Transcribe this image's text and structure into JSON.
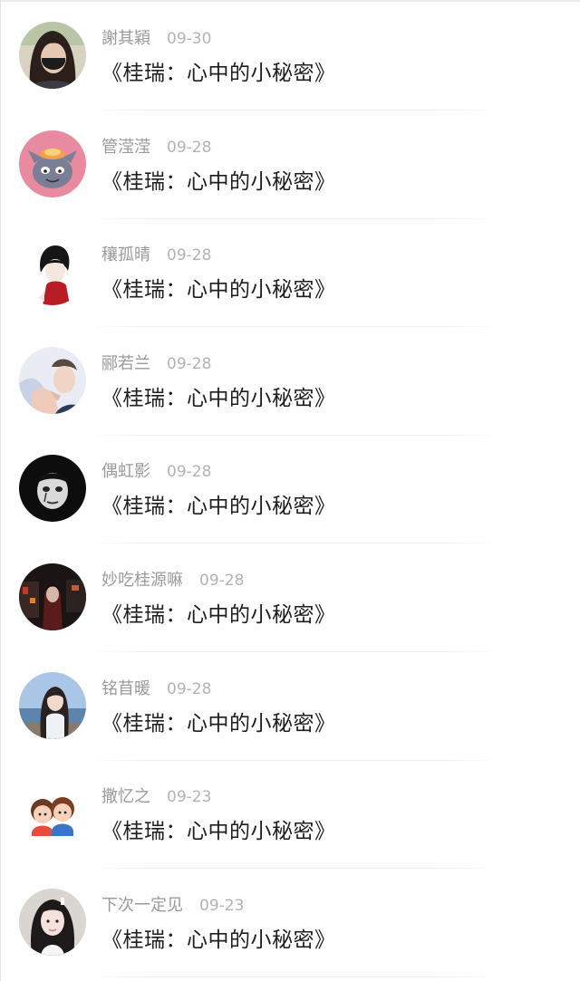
{
  "comments": [
    {
      "user": "謝其穎",
      "time": "09-30",
      "text": "《桂瑞：心中的小秘密》",
      "avatar": "girl-with-mask-avatar"
    },
    {
      "user": "管滢滢",
      "time": "09-28",
      "text": "《桂瑞：心中的小秘密》",
      "avatar": "cartoon-cat-avatar"
    },
    {
      "user": "穰孤晴",
      "time": "09-28",
      "text": "《桂瑞：心中的小秘密》",
      "avatar": "anime-boy-avatar"
    },
    {
      "user": "郦若兰",
      "time": "09-28",
      "text": "《桂瑞：心中的小秘密》",
      "avatar": "boy-portrait-avatar"
    },
    {
      "user": "偶虹影",
      "time": "09-28",
      "text": "《桂瑞：心中的小秘密》",
      "avatar": "dark-face-avatar"
    },
    {
      "user": "妙吃桂源嘛",
      "time": "09-28",
      "text": "《桂瑞：心中的小秘密》",
      "avatar": "night-street-avatar"
    },
    {
      "user": "铭苜暖",
      "time": "09-28",
      "text": "《桂瑞：心中的小秘密》",
      "avatar": "girl-by-sea-avatar"
    },
    {
      "user": "撒忆之",
      "time": "09-23",
      "text": "《桂瑞：心中的小秘密》",
      "avatar": "cartoon-couple-avatar"
    },
    {
      "user": "下次一定见",
      "time": "09-23",
      "text": "《桂瑞：心中的小秘密》",
      "avatar": "girl-selfie-avatar"
    }
  ]
}
